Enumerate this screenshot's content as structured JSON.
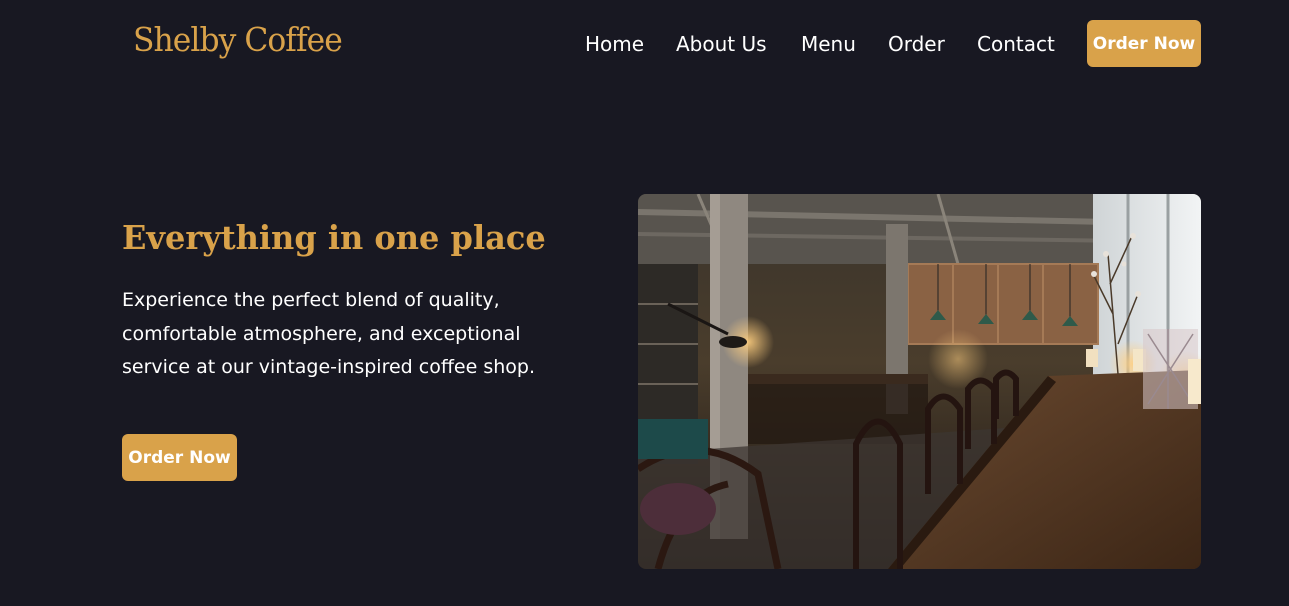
{
  "navbar": {
    "brand": "Shelby Coffee",
    "links": [
      "Home",
      "About Us",
      "Menu",
      "Order",
      "Contact"
    ],
    "cta_label": "Order Now"
  },
  "hero": {
    "title": "Everything in one place",
    "description": "Experience the perfect blend of quality, comfortable atmosphere, and exceptional service at our vintage-inspired coffee shop.",
    "cta_label": "Order Now",
    "image_icon": "coffee-shop-interior-photo"
  },
  "colors": {
    "background": "#181822",
    "accent": "#d9a24a",
    "text": "#ffffff"
  }
}
